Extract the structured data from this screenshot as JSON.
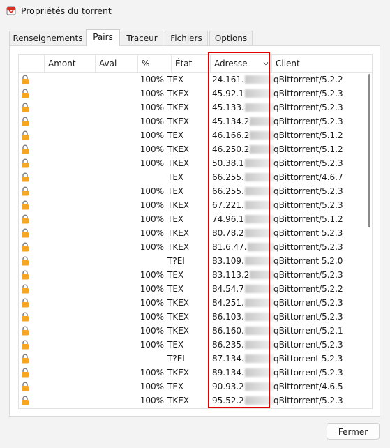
{
  "window": {
    "title": "Propriétés du torrent"
  },
  "tabs": [
    "Renseignements",
    "Pairs",
    "Traceur",
    "Fichiers",
    "Options"
  ],
  "active_tab": "Pairs",
  "columns": {
    "amont": "Amont",
    "aval": "Aval",
    "percent": "%",
    "state": "État",
    "address": "Adresse",
    "client": "Client"
  },
  "peers": [
    {
      "percent": "100%",
      "state": "TEX",
      "address": "24.161.",
      "client": "qBittorrent/5.2.2"
    },
    {
      "percent": "100%",
      "state": "TKEX",
      "address": "45.92.1",
      "client": "qBittorrent/5.2.3"
    },
    {
      "percent": "100%",
      "state": "TKEX",
      "address": "45.133.",
      "client": "qBittorrent/5.2.3"
    },
    {
      "percent": "100%",
      "state": "TKEX",
      "address": "45.134.2",
      "client": "qBittorrent/5.2.3"
    },
    {
      "percent": "100%",
      "state": "TEX",
      "address": "46.166.2",
      "client": "qBittorrent/5.1.2"
    },
    {
      "percent": "100%",
      "state": "TKEX",
      "address": "46.250.2",
      "client": "qBittorrent/5.1.2"
    },
    {
      "percent": "100%",
      "state": "TKEX",
      "address": "50.38.1",
      "client": "qBittorrent/5.2.3"
    },
    {
      "percent": "",
      "state": "TEX",
      "address": "66.255.",
      "client": "qBittorrent/4.6.7"
    },
    {
      "percent": "100%",
      "state": "TEX",
      "address": "66.255.",
      "client": "qBittorrent/5.2.3"
    },
    {
      "percent": "100%",
      "state": "TKEX",
      "address": "67.221.",
      "client": "qBittorrent/5.2.3"
    },
    {
      "percent": "100%",
      "state": "TEX",
      "address": "74.96.1",
      "client": "qBittorrent/5.1.2"
    },
    {
      "percent": "100%",
      "state": "TKEX",
      "address": "80.78.2",
      "client": "qBittorrent 5.2.3"
    },
    {
      "percent": "100%",
      "state": "TKEX",
      "address": "81.6.47.",
      "client": "qBittorrent/5.2.3"
    },
    {
      "percent": "",
      "state": "T?EI",
      "address": "83.109.",
      "client": "qBittorrent 5.2.0"
    },
    {
      "percent": "100%",
      "state": "TEX",
      "address": "83.113.2",
      "client": "qBittorrent/5.2.3"
    },
    {
      "percent": "100%",
      "state": "TEX",
      "address": "84.54.7",
      "client": "qBittorrent/5.2.2"
    },
    {
      "percent": "100%",
      "state": "TKEX",
      "address": "84.251.",
      "client": "qBittorrent/5.2.3"
    },
    {
      "percent": "100%",
      "state": "TKEX",
      "address": "86.103.",
      "client": "qBittorrent/5.2.3"
    },
    {
      "percent": "100%",
      "state": "TKEX",
      "address": "86.160.",
      "client": "qBittorrent/5.2.1"
    },
    {
      "percent": "100%",
      "state": "TEX",
      "address": "86.235.",
      "client": "qBittorrent/5.2.3"
    },
    {
      "percent": "",
      "state": "T?EI",
      "address": "87.134.",
      "client": "qBittorrent 5.2.3"
    },
    {
      "percent": "100%",
      "state": "TKEX",
      "address": "89.134.",
      "client": "qBittorrent/5.2.3"
    },
    {
      "percent": "100%",
      "state": "TEX",
      "address": "90.93.2",
      "client": "qBittorrent/4.6.5"
    },
    {
      "percent": "100%",
      "state": "TKEX",
      "address": "95.52.2",
      "client": "qBittorrent/5.2.3"
    }
  ],
  "buttons": {
    "close": "Fermer"
  },
  "colors": {
    "highlight": "#e00000",
    "lock": "#f5a623"
  }
}
